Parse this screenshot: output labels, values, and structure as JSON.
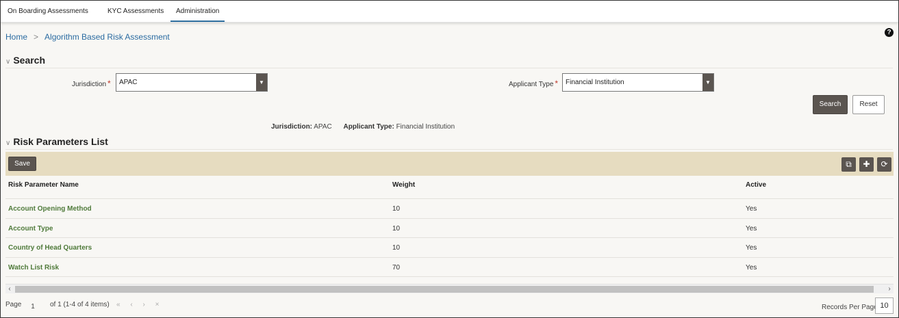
{
  "tabs": [
    {
      "label": "On Boarding Assessments"
    },
    {
      "label": "KYC Assessments"
    },
    {
      "label": "Administration"
    }
  ],
  "breadcrumb": {
    "home": "Home",
    "current": "Algorithm Based Risk Assessment"
  },
  "help_icon": "?",
  "search": {
    "title": "Search",
    "jurisdiction_label": "Jurisdiction",
    "jurisdiction_value": "APAC",
    "applicant_type_label": "Applicant Type",
    "applicant_type_value": "Financial Institution",
    "search_button": "Search",
    "reset_button": "Reset",
    "required_mark": "*"
  },
  "summary": {
    "jurisdiction_label": "Jurisdiction:",
    "jurisdiction_value": "APAC",
    "applicant_type_label": "Applicant Type:",
    "applicant_type_value": "Financial Institution"
  },
  "risk_list": {
    "title": "Risk Parameters List",
    "save_button": "Save",
    "toolbar_icons": [
      "export-icon",
      "add-icon",
      "refresh-icon"
    ],
    "columns": [
      "Risk Parameter Name",
      "Weight",
      "Active"
    ],
    "rows": [
      {
        "name": "Account Opening Method",
        "weight": "10",
        "active": "Yes"
      },
      {
        "name": "Account Type",
        "weight": "10",
        "active": "Yes"
      },
      {
        "name": "Country of Head Quarters",
        "weight": "10",
        "active": "Yes"
      },
      {
        "name": "Watch List Risk",
        "weight": "70",
        "active": "Yes"
      }
    ]
  },
  "pager": {
    "page_label": "Page",
    "page_number": "1",
    "of_text": "of 1 (1-4 of 4 items)",
    "records_per_page_label": "Records Per Page",
    "records_per_page_value": "10"
  },
  "colors": {
    "accent": "#5b5550",
    "toolbar_bg": "#e6dcc0",
    "link_green": "#4f7a3a",
    "link_blue": "#2a6ba1"
  }
}
